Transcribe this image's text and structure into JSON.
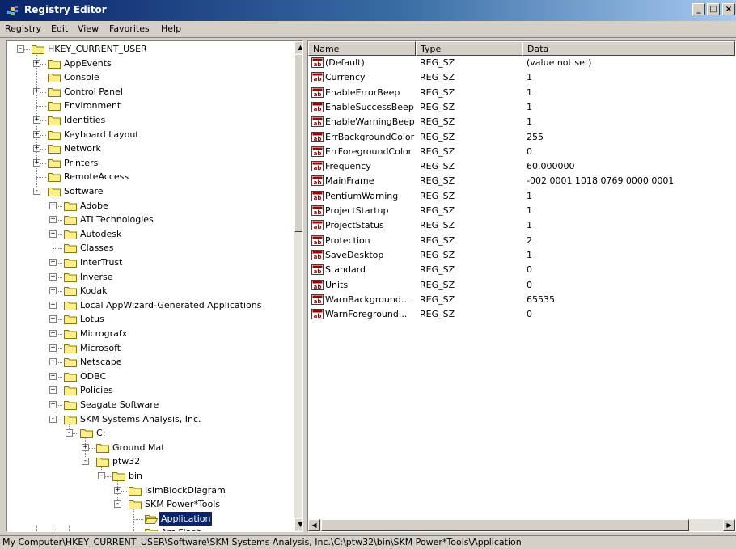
{
  "window": {
    "title": "Registry Editor",
    "controls": {
      "minimize": "_",
      "maximize": "□",
      "close": "×"
    }
  },
  "menu": [
    "Registry",
    "Edit",
    "View",
    "Favorites",
    "Help"
  ],
  "tree": [
    {
      "label": "HKEY_CURRENT_USER",
      "depth": 0,
      "exp": "-"
    },
    {
      "label": "AppEvents",
      "depth": 1,
      "exp": "+"
    },
    {
      "label": "Console",
      "depth": 1,
      "exp": ""
    },
    {
      "label": "Control Panel",
      "depth": 1,
      "exp": "+"
    },
    {
      "label": "Environment",
      "depth": 1,
      "exp": ""
    },
    {
      "label": "Identities",
      "depth": 1,
      "exp": "+"
    },
    {
      "label": "Keyboard Layout",
      "depth": 1,
      "exp": "+"
    },
    {
      "label": "Network",
      "depth": 1,
      "exp": "+"
    },
    {
      "label": "Printers",
      "depth": 1,
      "exp": "+"
    },
    {
      "label": "RemoteAccess",
      "depth": 1,
      "exp": ""
    },
    {
      "label": "Software",
      "depth": 1,
      "exp": "-"
    },
    {
      "label": "Adobe",
      "depth": 2,
      "exp": "+"
    },
    {
      "label": "ATI Technologies",
      "depth": 2,
      "exp": "+"
    },
    {
      "label": "Autodesk",
      "depth": 2,
      "exp": "+"
    },
    {
      "label": "Classes",
      "depth": 2,
      "exp": ""
    },
    {
      "label": "InterTrust",
      "depth": 2,
      "exp": "+"
    },
    {
      "label": "Inverse",
      "depth": 2,
      "exp": "+"
    },
    {
      "label": "Kodak",
      "depth": 2,
      "exp": "+"
    },
    {
      "label": "Local AppWizard-Generated Applications",
      "depth": 2,
      "exp": "+"
    },
    {
      "label": "Lotus",
      "depth": 2,
      "exp": "+"
    },
    {
      "label": "Micrografx",
      "depth": 2,
      "exp": "+"
    },
    {
      "label": "Microsoft",
      "depth": 2,
      "exp": "+"
    },
    {
      "label": "Netscape",
      "depth": 2,
      "exp": "+"
    },
    {
      "label": "ODBC",
      "depth": 2,
      "exp": "+"
    },
    {
      "label": "Policies",
      "depth": 2,
      "exp": "+"
    },
    {
      "label": "Seagate Software",
      "depth": 2,
      "exp": "+"
    },
    {
      "label": "SKM Systems Analysis, Inc.",
      "depth": 2,
      "exp": "-"
    },
    {
      "label": "C:",
      "depth": 3,
      "exp": "-"
    },
    {
      "label": "Ground Mat",
      "depth": 4,
      "exp": "+"
    },
    {
      "label": "ptw32",
      "depth": 4,
      "exp": "-"
    },
    {
      "label": "bin",
      "depth": 5,
      "exp": "-"
    },
    {
      "label": "IsimBlockDiagram",
      "depth": 6,
      "exp": "+"
    },
    {
      "label": "SKM Power*Tools",
      "depth": 6,
      "exp": "-"
    },
    {
      "label": "Application",
      "depth": 7,
      "exp": "",
      "selected": true,
      "open": true
    },
    {
      "label": "Arc Flash",
      "depth": 7,
      "exp": ""
    }
  ],
  "list": {
    "columns": [
      "Name",
      "Type",
      "Data"
    ],
    "rows": [
      {
        "name": "(Default)",
        "type": "REG_SZ",
        "data": "(value not set)"
      },
      {
        "name": "Currency",
        "type": "REG_SZ",
        "data": "1"
      },
      {
        "name": "EnableErrorBeep",
        "type": "REG_SZ",
        "data": "1"
      },
      {
        "name": "EnableSuccessBeep",
        "type": "REG_SZ",
        "data": "1"
      },
      {
        "name": "EnableWarningBeep",
        "type": "REG_SZ",
        "data": "1"
      },
      {
        "name": "ErrBackgroundColor",
        "type": "REG_SZ",
        "data": "255"
      },
      {
        "name": "ErrForegroundColor",
        "type": "REG_SZ",
        "data": "0"
      },
      {
        "name": "Frequency",
        "type": "REG_SZ",
        "data": "60.000000"
      },
      {
        "name": "MainFrame",
        "type": "REG_SZ",
        "data": "-002 0001 1018 0769 0000 0001"
      },
      {
        "name": "PentiumWarning",
        "type": "REG_SZ",
        "data": "1"
      },
      {
        "name": "ProjectStartup",
        "type": "REG_SZ",
        "data": "1"
      },
      {
        "name": "ProjectStatus",
        "type": "REG_SZ",
        "data": "1"
      },
      {
        "name": "Protection",
        "type": "REG_SZ",
        "data": "2"
      },
      {
        "name": "SaveDesktop",
        "type": "REG_SZ",
        "data": "1"
      },
      {
        "name": "Standard",
        "type": "REG_SZ",
        "data": "0"
      },
      {
        "name": "Units",
        "type": "REG_SZ",
        "data": "0"
      },
      {
        "name": "WarnBackground...",
        "type": "REG_SZ",
        "data": "65535"
      },
      {
        "name": "WarnForeground...",
        "type": "REG_SZ",
        "data": "0"
      }
    ]
  },
  "status": "My Computer\\HKEY_CURRENT_USER\\Software\\SKM Systems Analysis, Inc.\\C:\\ptw32\\bin\\SKM Power*Tools\\Application",
  "colors": {
    "title_start": "#0a246a",
    "title_end": "#a6caf0",
    "selection": "#0a246a",
    "face": "#d4d0c8"
  }
}
